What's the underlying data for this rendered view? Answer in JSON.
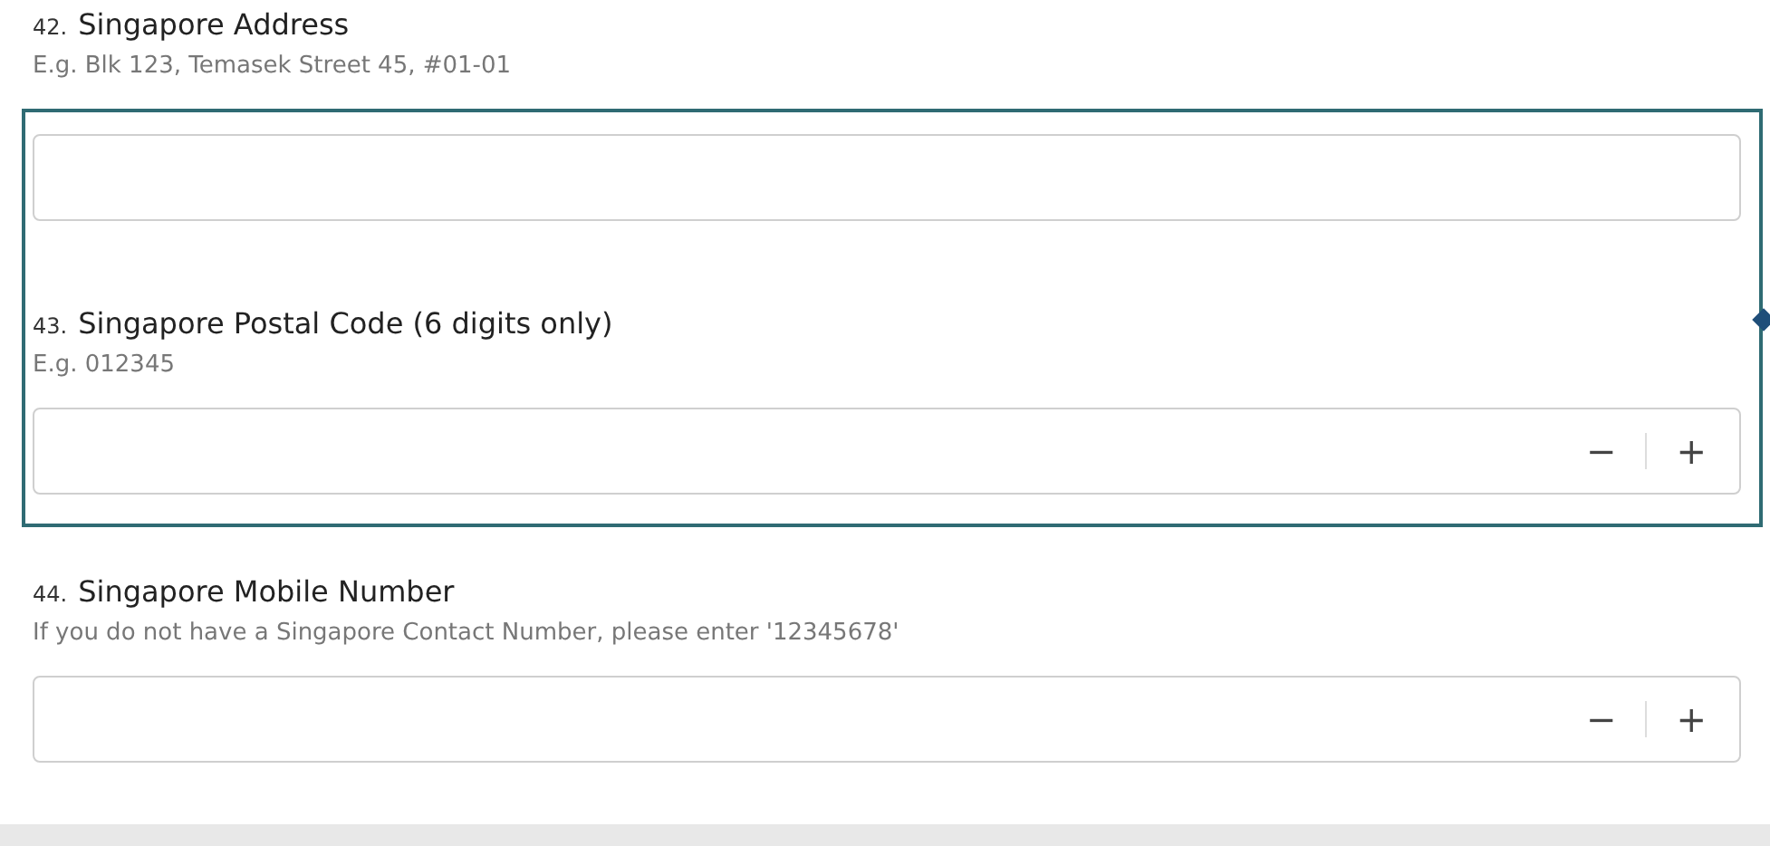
{
  "questions": [
    {
      "number": "42.",
      "title": "Singapore Address",
      "hint": "E.g. Blk 123, Temasek Street 45, #01-01",
      "kind": "text",
      "selected": false
    },
    {
      "number": "43.",
      "title": "Singapore Postal Code (6 digits only)",
      "hint": "E.g. 012345",
      "kind": "number",
      "selected": true,
      "minus": "−",
      "plus": "+"
    },
    {
      "number": "44.",
      "title": "Singapore Mobile Number",
      "hint": "If you do not have a Singapore Contact Number, please enter '12345678'",
      "kind": "number",
      "selected": false,
      "minus": "−",
      "plus": "+"
    }
  ]
}
